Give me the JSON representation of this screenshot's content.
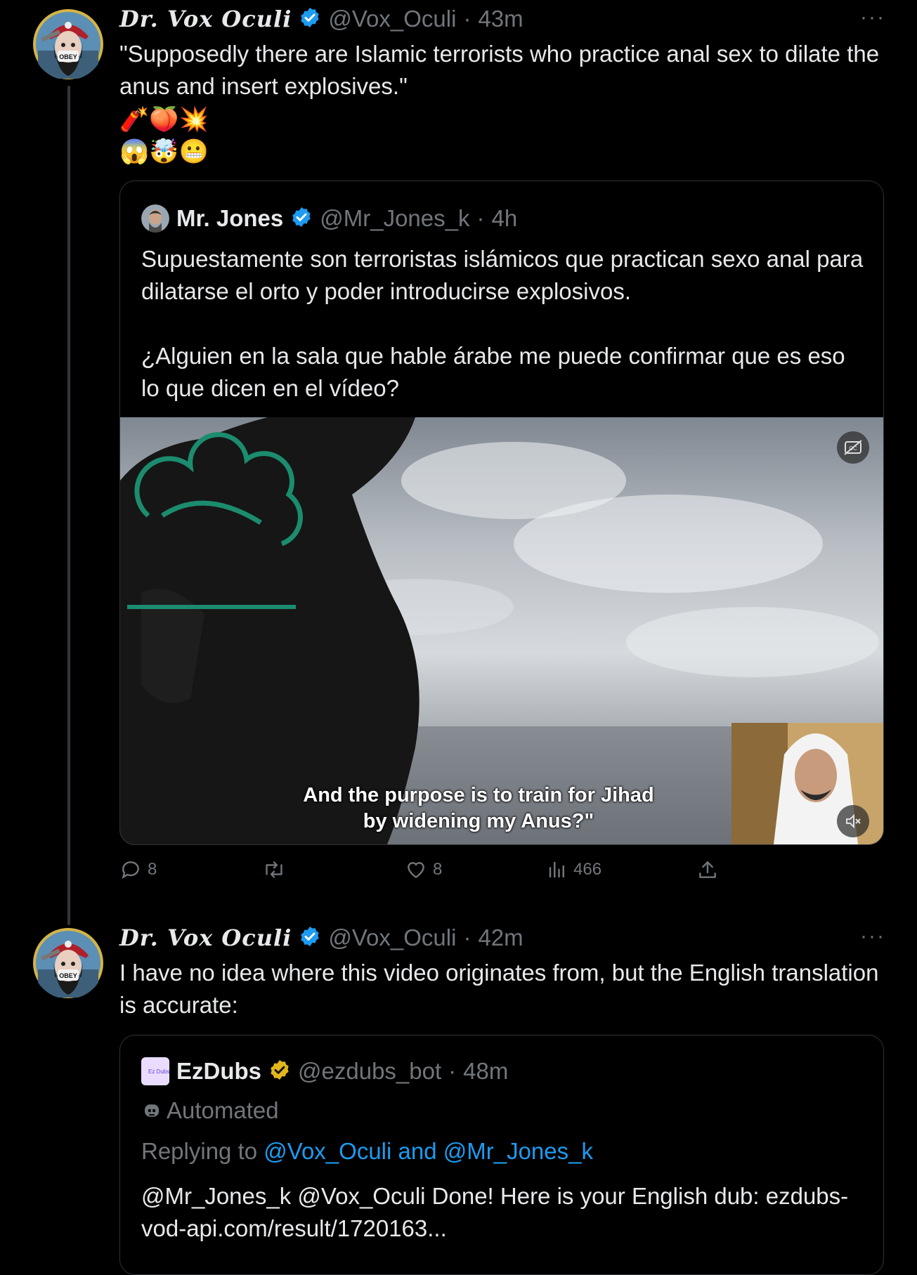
{
  "post1": {
    "author_name": "Dr. Vox Oculi",
    "handle": "@Vox_Oculi",
    "time": "43m",
    "more": "···",
    "text": "\"Supposedly there are Islamic terrorists who practice anal sex to dilate the anus and insert explosives.\"",
    "emoji_line1": "🧨🍑💥",
    "emoji_line2": "😱🤯😬",
    "quote": {
      "author_name": "Mr. Jones",
      "handle": "@Mr_Jones_k",
      "time": "4h",
      "text_p1": "Supuestamente son terroristas islámicos que practican sexo anal para dilatarse el orto y poder introducirse explosivos.",
      "text_p2": "¿Alguien en la sala que hable árabe me puede confirmar que es eso lo que dicen en el vídeo?",
      "video_subtitle_line1": "And the purpose is to train for Jihad",
      "video_subtitle_line2": "by widening my Anus?\""
    },
    "actions": {
      "replies": "8",
      "retweets": "",
      "likes": "8",
      "views": "466"
    }
  },
  "post2": {
    "author_name": "Dr. Vox Oculi",
    "handle": "@Vox_Oculi",
    "time": "42m",
    "more": "···",
    "text": "I have no idea where this video originates from, but the English translation is accurate:",
    "quote": {
      "author_name": "EzDubs",
      "logo_text": "Ez Dubs",
      "handle": "@ezdubs_bot",
      "time": "48m",
      "automated_label": "Automated",
      "replying_prefix": "Replying to ",
      "replying_to": "@Vox_Oculi and @Mr_Jones_k",
      "text": "@Mr_Jones_k @Vox_Oculi Done! Here is your English dub: ezdubs-vod-api.com/result/1720163..."
    }
  },
  "colors": {
    "background": "#000000",
    "text": "#e7e9ea",
    "muted": "#71767b",
    "link": "#1d9bf0",
    "verified_blue": "#1d9bf0",
    "verified_gold": "#e2b719",
    "border": "#2f3336"
  }
}
